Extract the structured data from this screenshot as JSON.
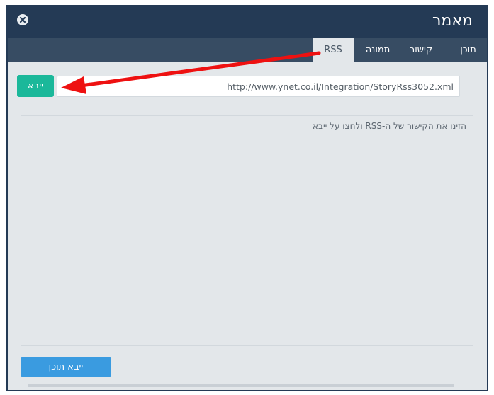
{
  "dialog": {
    "title": "מאמר",
    "close_icon": "close-icon"
  },
  "tabs": [
    {
      "label": "תוכן",
      "active": false
    },
    {
      "label": "קישור",
      "active": false
    },
    {
      "label": "תמונה",
      "active": false
    },
    {
      "label": "RSS",
      "active": true
    }
  ],
  "rss": {
    "url_value": "http://www.ynet.co.il/Integration/StoryRss3052.xml",
    "import_label": "ייבא",
    "hint": "הזינו את הקישור של ה-RSS ולחצו על ייבא"
  },
  "footer": {
    "import_content_label": "ייבא תוכן"
  },
  "colors": {
    "header": "#243a55",
    "tabbar": "#374c63",
    "body": "#e3e7ea",
    "import_button": "#1bb89a",
    "footer_button": "#3a9be0",
    "annotation_arrow": "#ee1111"
  },
  "annotation": {
    "arrow_icon": "red-arrow-icon"
  }
}
